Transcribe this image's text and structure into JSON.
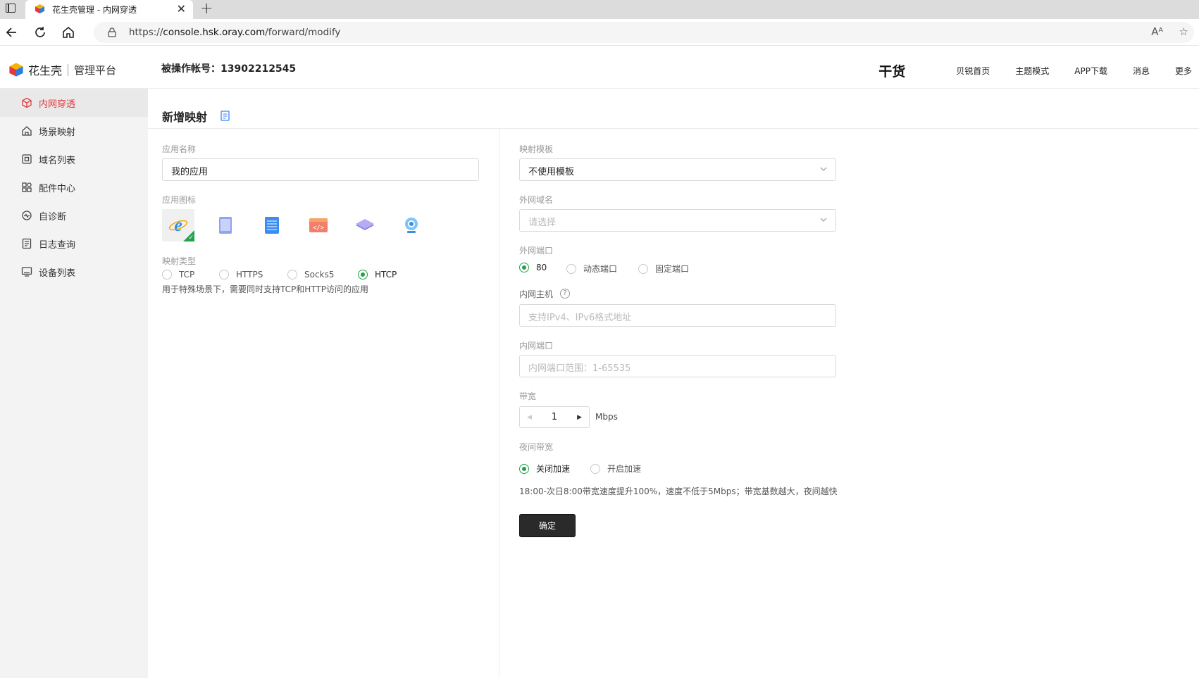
{
  "browser": {
    "tab_title": "花生壳管理 - 内网穿透",
    "tab_close": "✕",
    "new_tab": "+",
    "url_prefix": "https://",
    "url_domain": "console.hsk.oray.com",
    "url_path": "/forward/modify",
    "read_aloud": "Aᴬ",
    "favorites": "☆"
  },
  "header": {
    "brand": "花生壳",
    "brand_sub": "管理平台",
    "account_label": "被操作帐号：",
    "account_value": "13902212545",
    "nav_logo": "干货",
    "nav": [
      "贝锐首页",
      "主题模式",
      "APP下载",
      "消息",
      "更多"
    ]
  },
  "sidebar": {
    "items": [
      {
        "label": "内网穿透",
        "icon": "cube-icon",
        "active": true
      },
      {
        "label": "场景映射",
        "icon": "house-icon"
      },
      {
        "label": "域名列表",
        "icon": "domain-icon"
      },
      {
        "label": "配件中心",
        "icon": "grid-icon"
      },
      {
        "label": "自诊断",
        "icon": "diagnose-icon"
      },
      {
        "label": "日志查询",
        "icon": "log-icon"
      },
      {
        "label": "设备列表",
        "icon": "monitor-icon"
      }
    ]
  },
  "page": {
    "title": "新增映射"
  },
  "form_left": {
    "app_name_label": "应用名称",
    "app_name_value": "我的应用",
    "app_icon_label": "应用图标",
    "mapping_type_label": "映射类型",
    "mapping_types": [
      "TCP",
      "HTTPS",
      "Socks5",
      "HTCP"
    ],
    "mapping_type_selected": "HTCP",
    "mapping_hint": "用于特殊场景下，需要同时支持TCP和HTTP访问的应用"
  },
  "form_right": {
    "template_label": "映射模板",
    "template_value": "不使用模板",
    "domain_label": "外网域名",
    "domain_placeholder": "请选择",
    "ext_port_label": "外网端口",
    "ext_port_options": [
      "80",
      "动态端口",
      "固定端口"
    ],
    "ext_port_selected": "80",
    "host_label": "内网主机",
    "help_symbol": "?",
    "host_placeholder": "支持IPv4、IPv6格式地址",
    "int_port_label": "内网端口",
    "int_port_placeholder": "内网端口范围：1-65535",
    "bandwidth_label": "带宽",
    "bandwidth_value": "1",
    "bandwidth_unit": "Mbps",
    "night_label": "夜间带宽",
    "night_options": [
      "关闭加速",
      "开启加速"
    ],
    "night_selected": "关闭加速",
    "night_hint": "18:00-次日8:00带宽速度提升100%，速度不低于5Mbps；带宽基数越大，夜间越快",
    "submit": "确定"
  },
  "colors": {
    "accent_green": "#22a24a",
    "active_red": "#e4393c",
    "button_dark": "#2a2a2a"
  }
}
